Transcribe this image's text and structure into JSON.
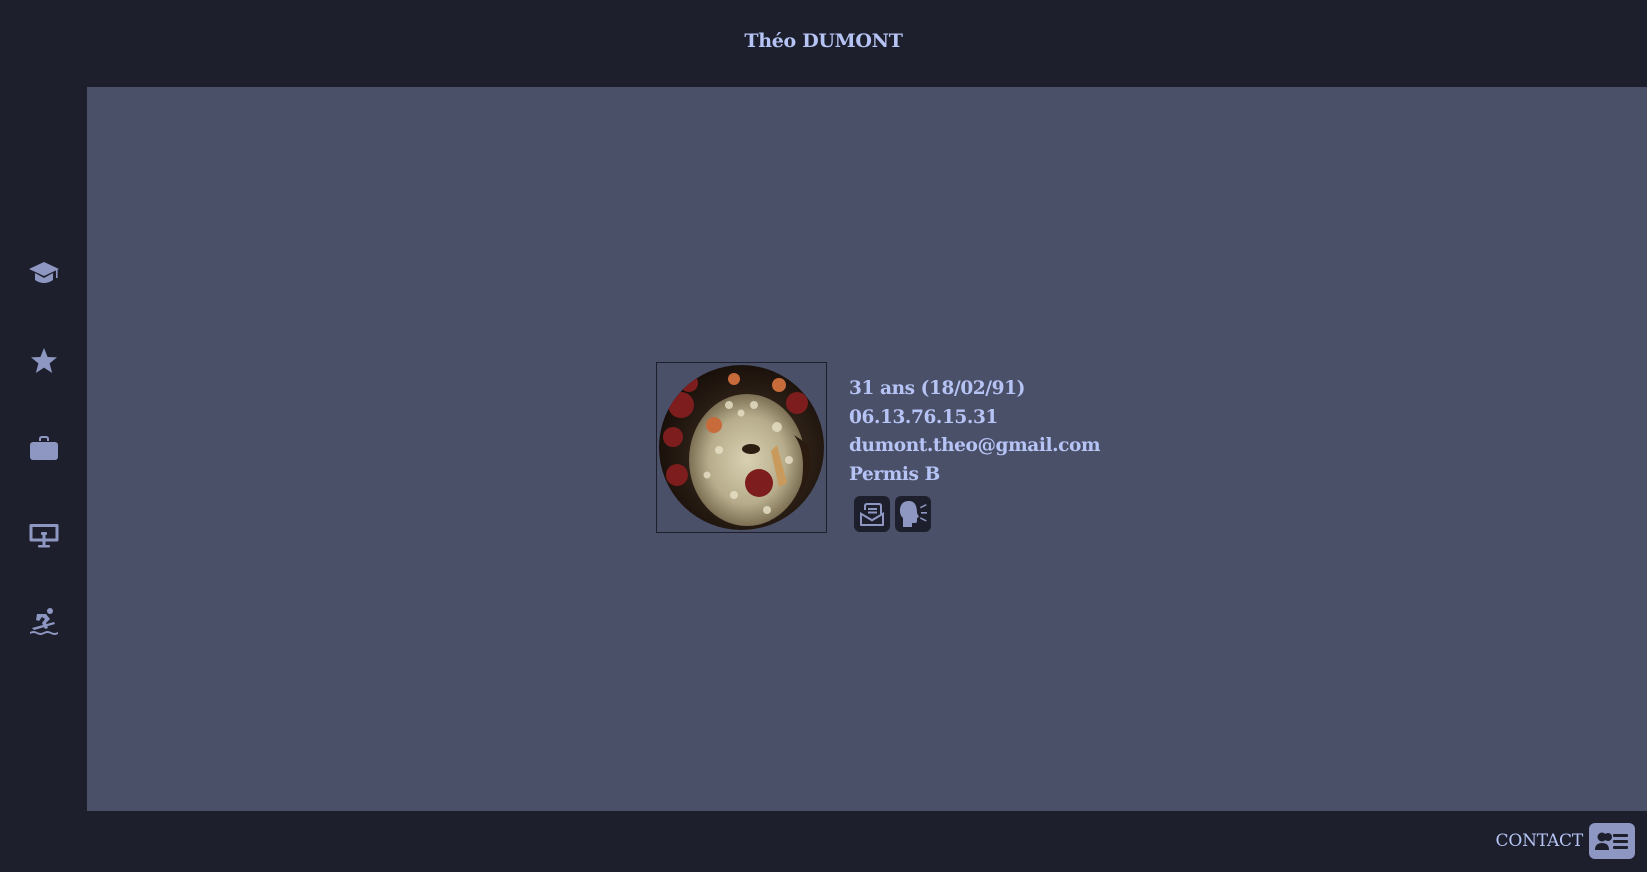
{
  "header": {
    "title": "Théo DUMONT"
  },
  "sidebar": {
    "items": [
      {
        "name": "formation",
        "icon": "graduation-cap-icon"
      },
      {
        "name": "competences",
        "icon": "star-icon"
      },
      {
        "name": "experience",
        "icon": "briefcase-icon"
      },
      {
        "name": "projets",
        "icon": "desktop-icon"
      },
      {
        "name": "loisirs",
        "icon": "surfing-icon"
      }
    ]
  },
  "profile": {
    "age": "31 ans (18/02/91)",
    "phone": "06.13.76.15.31",
    "email": "dumont.theo@gmail.com",
    "license": "Permis B",
    "badges": [
      {
        "icon": "mail-envelope-icon"
      },
      {
        "icon": "speaking-head-icon"
      }
    ]
  },
  "footer": {
    "contact_label": "CONTACT",
    "contact_icon": "address-card-icon"
  },
  "colors": {
    "background_dark": "#1d202c",
    "main_panel": "#4b5069",
    "text_accent": "#b6c3f5",
    "icon_muted": "#8e97c1"
  }
}
